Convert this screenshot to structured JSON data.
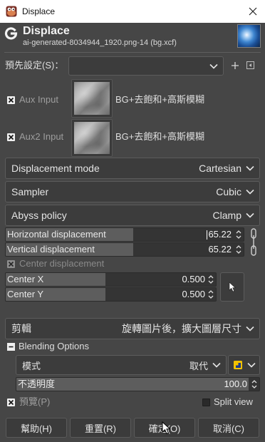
{
  "window": {
    "title": "Displace"
  },
  "header": {
    "title": "Displace",
    "subtitle": "ai-generated-8034944_1920.png-14 (bg.xcf)"
  },
  "presets": {
    "label": "預先設定(S)：",
    "value": ""
  },
  "aux_inputs": [
    {
      "label": "Aux Input",
      "checked": true,
      "source": "BG+去飽和+高斯模糊"
    },
    {
      "label": "Aux2 Input",
      "checked": true,
      "source": "BG+去飽和+高斯模糊"
    }
  ],
  "combos": {
    "displacement_mode": {
      "label": "Displacement mode",
      "value": "Cartesian"
    },
    "sampler": {
      "label": "Sampler",
      "value": "Cubic"
    },
    "abyss_policy": {
      "label": "Abyss policy",
      "value": "Clamp"
    }
  },
  "displacement": {
    "horizontal": {
      "label": "Horizontal displacement",
      "value": "65.22",
      "level": 0.56
    },
    "vertical": {
      "label": "Vertical displacement",
      "value": "65.22",
      "level": 0.56
    },
    "chain_linked": true
  },
  "center": {
    "toggle": {
      "label": "Center displacement",
      "checked": true,
      "enabled": false
    },
    "x": {
      "label": "Center X",
      "value": "0.500",
      "level": 0.5
    },
    "y": {
      "label": "Center Y",
      "value": "0.500",
      "level": 0.5
    }
  },
  "clipping": {
    "label": "剪輯",
    "value": "旋轉圖片後，擴大圖層尺寸"
  },
  "blending": {
    "label": "Blending Options",
    "expanded": true,
    "mode": {
      "label": "模式",
      "value": "取代"
    },
    "opacity": {
      "label": "不透明度",
      "value": "100.0",
      "level": 1.0
    }
  },
  "preview": {
    "label": "預覽(P)",
    "checked": true
  },
  "split_view": {
    "label": "Split view",
    "checked": false
  },
  "buttons": {
    "help": "幫助(H)",
    "reset": "重置(R)",
    "ok": "確定(O)",
    "cancel": "取消(C)"
  },
  "icons": {
    "app": "gimp-icon",
    "close": "close-icon",
    "operation": "gegl-icon",
    "add_preset": "plus-icon",
    "preset_menu": "preset-menu-icon",
    "dropdown": "chevron-down-icon",
    "spin": "spin-arrows-icon",
    "chain": "chain-icon",
    "pick": "pointer-icon",
    "expander": "minus-icon",
    "composite": "composite-mode-icon",
    "cursor": "mouse-cursor-icon"
  },
  "colors": {
    "background": "#464646",
    "slider_fill": "#5d5d5d",
    "text": "#dedede"
  }
}
